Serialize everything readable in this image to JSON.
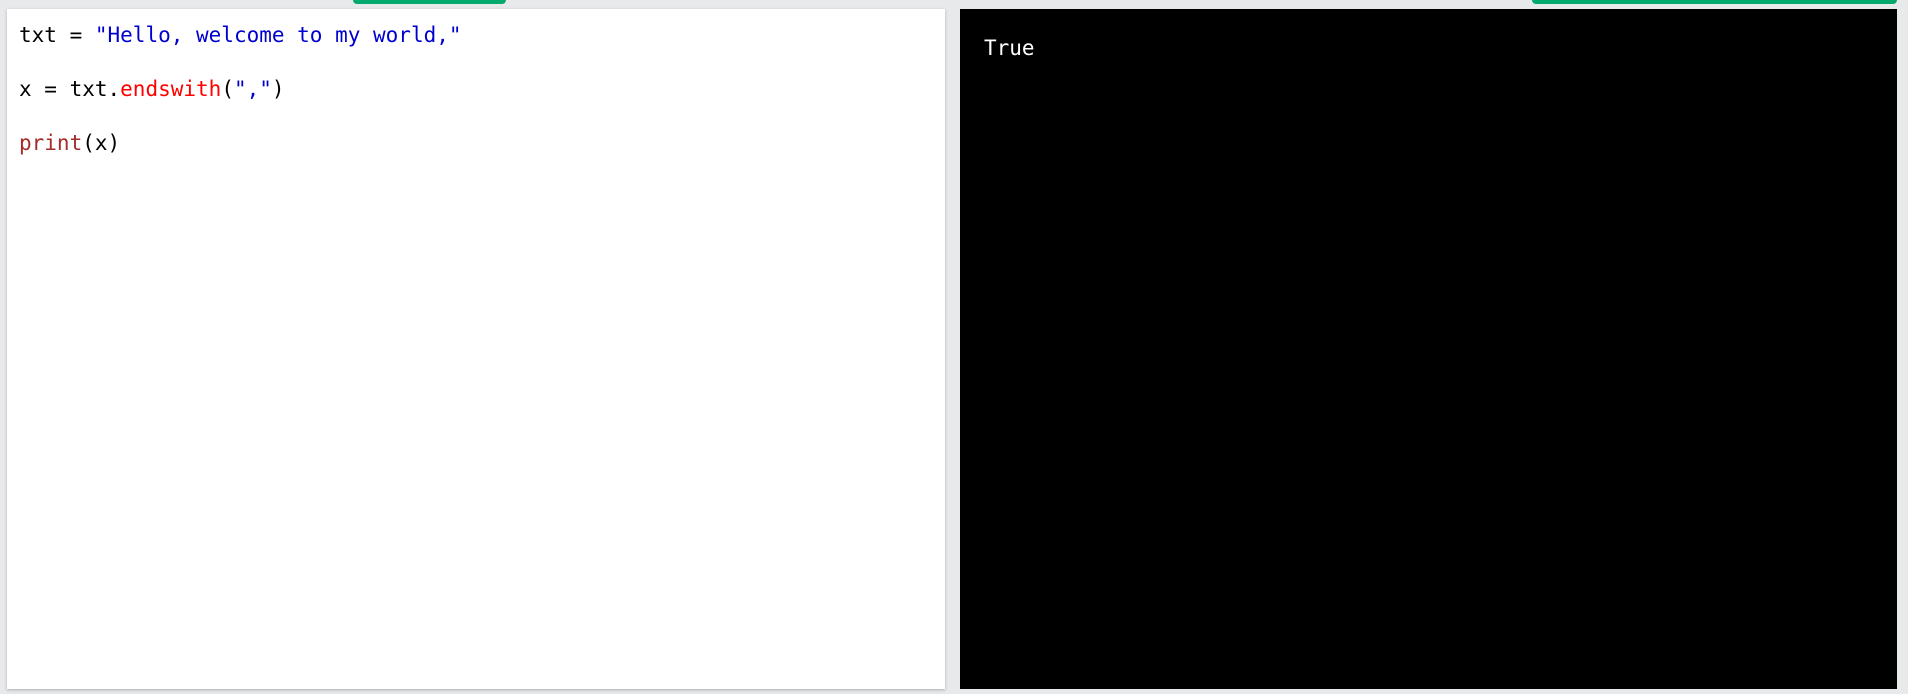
{
  "colors": {
    "accent": "#04aa6d",
    "string": "#0000cd",
    "method": "#ff0000",
    "builtin": "#a52a2a",
    "output_bg": "#000000",
    "output_text": "#ffffff"
  },
  "editor": {
    "line1": {
      "var": "txt",
      "op": " = ",
      "str": "\"Hello, welcome to my world,\""
    },
    "line2": {
      "lhs": "x = txt.",
      "method": "endswith",
      "open": "(",
      "arg": "\",\"",
      "close": ")"
    },
    "line3": {
      "func": "print",
      "args": "(x)"
    }
  },
  "output": {
    "text": "True"
  }
}
